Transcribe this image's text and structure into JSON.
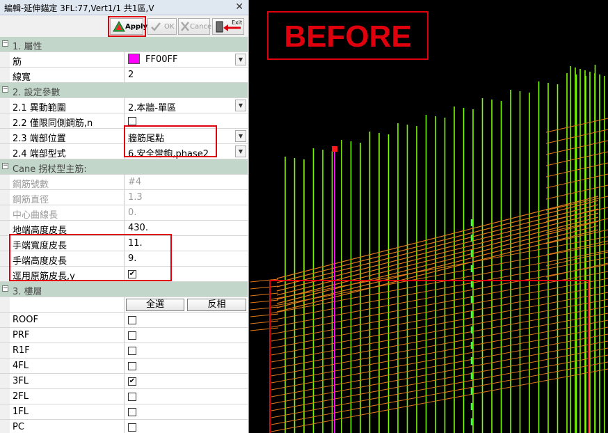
{
  "window": {
    "title": "編輯-延伸錨定 3FL:77,Vert1/1 共1區,V",
    "close_glyph": "✕"
  },
  "toolbar": {
    "apply_label": "Apply",
    "ok_label": "OK",
    "cancel_label": "Cancel",
    "exit_label": "Exit"
  },
  "toggle_glyph": "−",
  "dropdown_glyph": "▼",
  "check_glyph": "✔",
  "sections": {
    "attributes": "1. 屬性",
    "settings": "2. 設定參數",
    "cane": "Cane 拐杖型主筋:",
    "floors": "3. 樓層"
  },
  "attributes": {
    "rebar_label": "筋",
    "rebar_color_value": "FF00FF",
    "rebar_color": "#FF00FF",
    "line_width_label": "線寬",
    "line_width_value": "2"
  },
  "settings": {
    "range_label": "2.1 異動範圍",
    "range_value": "2.本牆-單區",
    "same_side_label": "2.2 僅限同側鋼筋,n",
    "same_side_checked": false,
    "end_position_label": "2.3 端部位置",
    "end_position_value": "牆筋尾點",
    "end_type_label": "2.4 端部型式",
    "end_type_value": "6.安全彎鉤,phase2"
  },
  "cane": {
    "bar_no_label": "鋼筋號數",
    "bar_no_value": "#4",
    "diameter_label": "鋼筋直徑",
    "diameter_value": "1.3",
    "center_len_label": "中心曲線長",
    "center_len_value": "0.",
    "ground_height_label": "地端高度皮長",
    "ground_height_value": "430.",
    "hand_width_label": "手端寬度皮長",
    "hand_width_value": "11.",
    "hand_height_label": "手端高度皮長",
    "hand_height_value": "9.",
    "apply_original_label": "逕用原筋皮長,y",
    "apply_original_checked": true
  },
  "floors": {
    "select_all_label": "全選",
    "invert_label": "反相",
    "items": [
      {
        "name": "ROOF",
        "checked": false
      },
      {
        "name": "PRF",
        "checked": false
      },
      {
        "name": "R1F",
        "checked": false
      },
      {
        "name": "4FL",
        "checked": false
      },
      {
        "name": "3FL",
        "checked": true
      },
      {
        "name": "2FL",
        "checked": false
      },
      {
        "name": "1FL",
        "checked": false
      },
      {
        "name": "PC",
        "checked": false
      }
    ]
  },
  "canvas": {
    "label": "BEFORE",
    "colors": {
      "label": "#E0000D",
      "vertical_bars": "#7CFC00",
      "horizontal_bars": "#E07A1A",
      "selected_bar": "#FF00FF"
    }
  }
}
